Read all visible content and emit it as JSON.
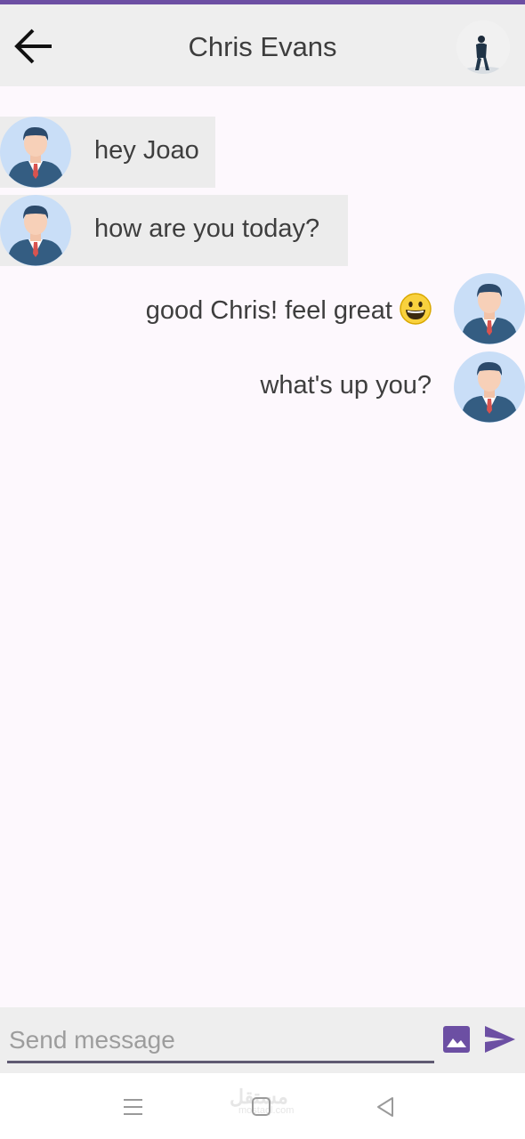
{
  "header": {
    "title": "Chris Evans",
    "back_icon": "arrow-left-icon",
    "avatar": "profile-photo-person-walking"
  },
  "messages": [
    {
      "direction": "incoming",
      "text": "hey Joao",
      "avatar": "businessman-avatar"
    },
    {
      "direction": "incoming",
      "text": "how are you today?",
      "avatar": "businessman-avatar"
    },
    {
      "direction": "outgoing",
      "text": "good Chris! feel great",
      "emoji": "grinning-face",
      "avatar": "businessman-avatar"
    },
    {
      "direction": "outgoing",
      "text": "what's up you?",
      "avatar": "businessman-avatar"
    }
  ],
  "composer": {
    "placeholder": "Send message",
    "value": "",
    "image_icon": "image-icon",
    "send_icon": "send-icon"
  },
  "navbar": {
    "watermark": "مستقل",
    "watermark_sub": "mostaql.com"
  },
  "colors": {
    "accent": "#6c4fa3",
    "header_bg": "#eeeeee",
    "incoming_bubble": "#ececec",
    "chat_bg": "#fdf8fd"
  }
}
